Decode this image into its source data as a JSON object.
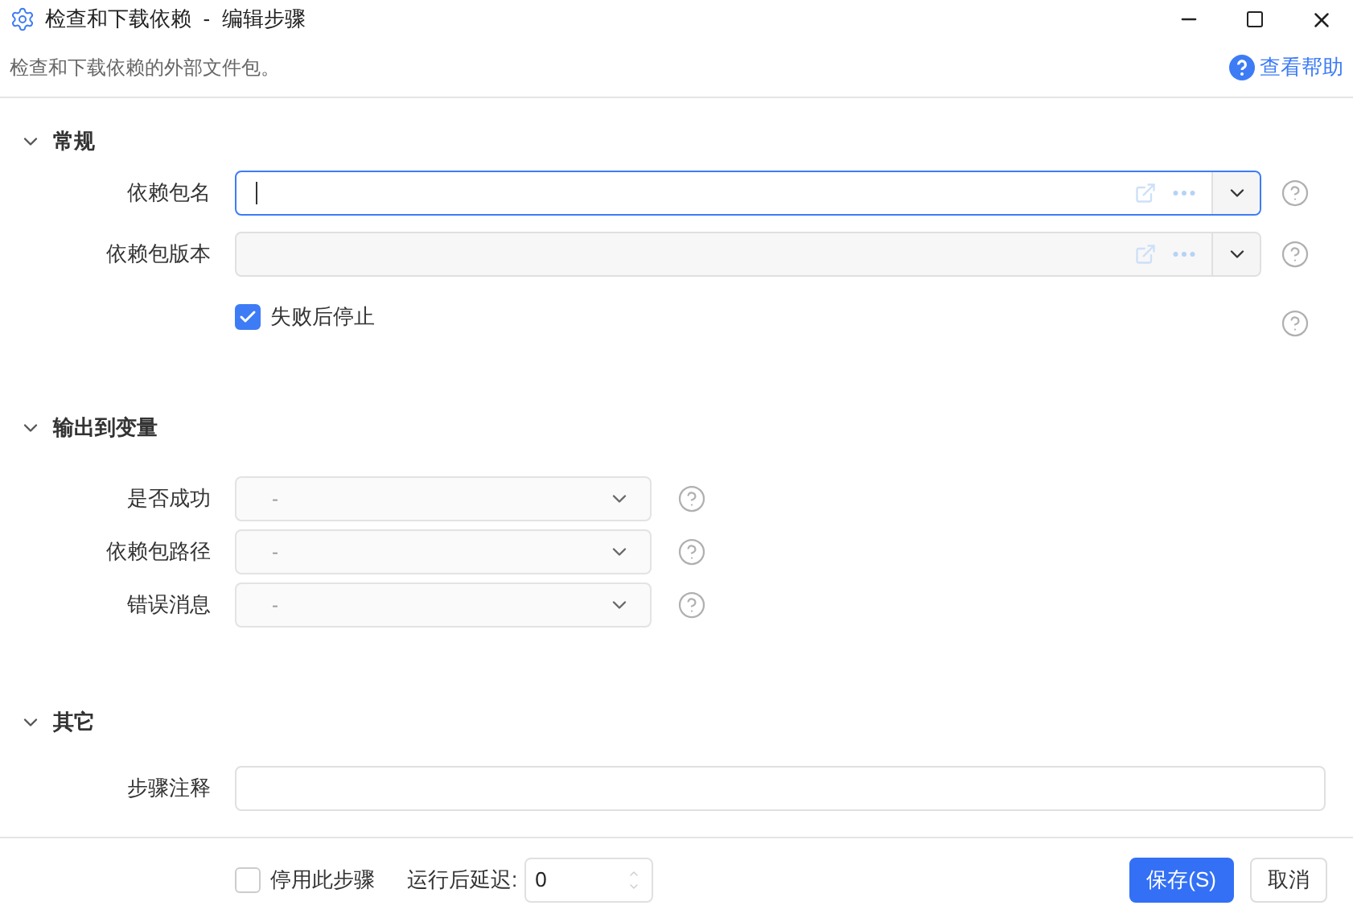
{
  "window": {
    "title": "检查和下载依赖  -  编辑步骤"
  },
  "description": "检查和下载依赖的外部文件包。",
  "help_link": "查看帮助",
  "sections": [
    {
      "title": "常规",
      "expanded": true,
      "fields": [
        {
          "kind": "combo",
          "label": "依赖包名",
          "focused": true
        },
        {
          "kind": "combo",
          "label": "依赖包版本",
          "focused": false
        },
        {
          "kind": "checkbox",
          "label": "失败后停止",
          "checked": true
        }
      ]
    },
    {
      "title": "输出到变量",
      "expanded": true,
      "fields": [
        {
          "kind": "select",
          "label": "是否成功",
          "placeholder": "-"
        },
        {
          "kind": "select",
          "label": "依赖包路径",
          "placeholder": "-"
        },
        {
          "kind": "select",
          "label": "错误消息",
          "placeholder": "-"
        }
      ]
    },
    {
      "title": "其它",
      "expanded": true,
      "fields": [
        {
          "kind": "text",
          "label": "步骤注释"
        }
      ]
    }
  ],
  "footer": {
    "disable_step": {
      "label": "停用此步骤",
      "checked": false
    },
    "delay": {
      "label": "运行后延迟:",
      "value": "0"
    },
    "buttons": [
      {
        "label": "保存(S)",
        "kind": "primary"
      },
      {
        "label": "取消",
        "kind": "secondary"
      }
    ]
  }
}
